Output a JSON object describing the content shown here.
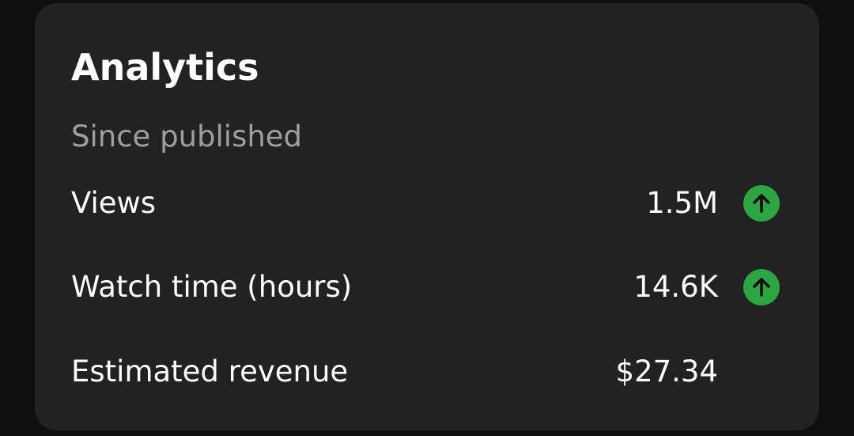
{
  "analytics": {
    "title": "Analytics",
    "subtitle": "Since published",
    "metrics": [
      {
        "label": "Views",
        "value": "1.5M",
        "trend": "up",
        "trend_icon": "arrow-up-icon"
      },
      {
        "label": "Watch time (hours)",
        "value": "14.6K",
        "trend": "up",
        "trend_icon": "arrow-up-icon"
      },
      {
        "label": "Estimated revenue",
        "value": "$27.34",
        "trend": null
      }
    ]
  },
  "colors": {
    "background": "#0f0f0f",
    "card": "#222222",
    "text_primary": "#ffffff",
    "text_secondary": "#9e9e9e",
    "trend_up": "#2ba640"
  }
}
